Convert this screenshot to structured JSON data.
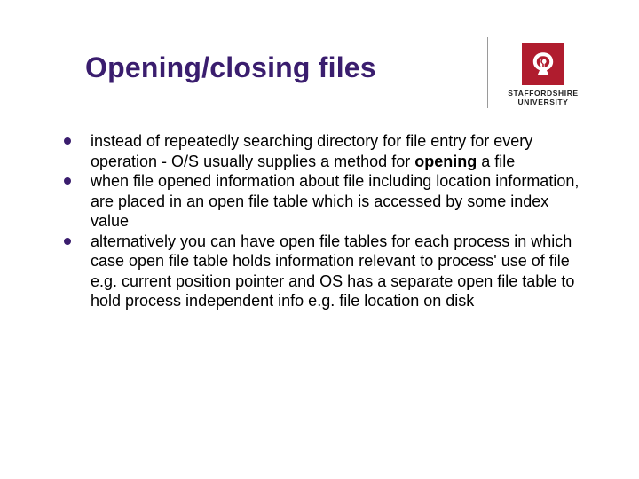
{
  "title": "Opening/closing files",
  "logo": {
    "line1": "STAFFORDSHIRE",
    "line2": "UNIVERSITY"
  },
  "bullets": [
    {
      "pre": "instead of repeatedly searching directory for file entry for every operation - O/S usually supplies a method for ",
      "bold": "opening",
      "post": " a file"
    },
    {
      "pre": "when file opened information about file including location information, are placed in an open file table which is accessed by some index value",
      "bold": "",
      "post": ""
    },
    {
      "pre": "alternatively you can have open file tables for each process in which case open file table holds information relevant to process' use of file e.g. current position pointer and OS has a separate open file table to hold process independent info e.g. file location on disk",
      "bold": "",
      "post": ""
    }
  ]
}
